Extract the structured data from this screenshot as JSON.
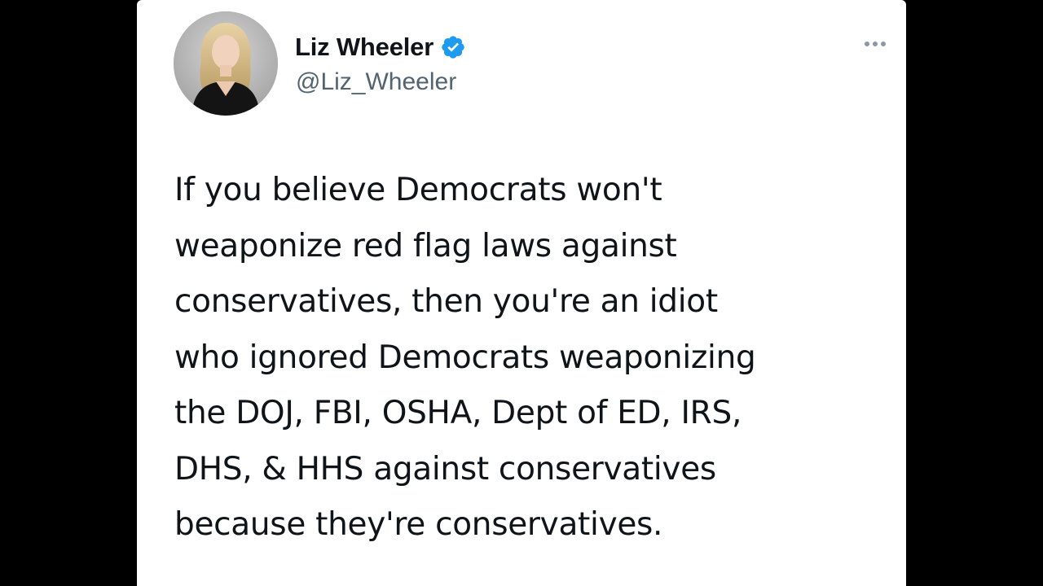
{
  "tweet": {
    "author": {
      "display_name": "Liz Wheeler",
      "handle": "@Liz_Wheeler",
      "verified": true
    },
    "text_lines": [
      "If you believe Democrats won't",
      "weaponize red flag laws against",
      "conservatives, then you're an idiot",
      "who ignored Democrats weaponizing",
      "the DOJ, FBI, OSHA, Dept of ED, IRS,",
      "DHS, & HHS against conservatives",
      "because they're conservatives."
    ]
  },
  "icons": {
    "verified": "verified-badge-icon",
    "more": "more-horizontal-icon"
  },
  "colors": {
    "background": "#000000",
    "card": "#ffffff",
    "text_primary": "#0f1419",
    "text_secondary": "#536471",
    "verified_blue": "#1d9bf0",
    "more_dots": "#8b98a5"
  }
}
